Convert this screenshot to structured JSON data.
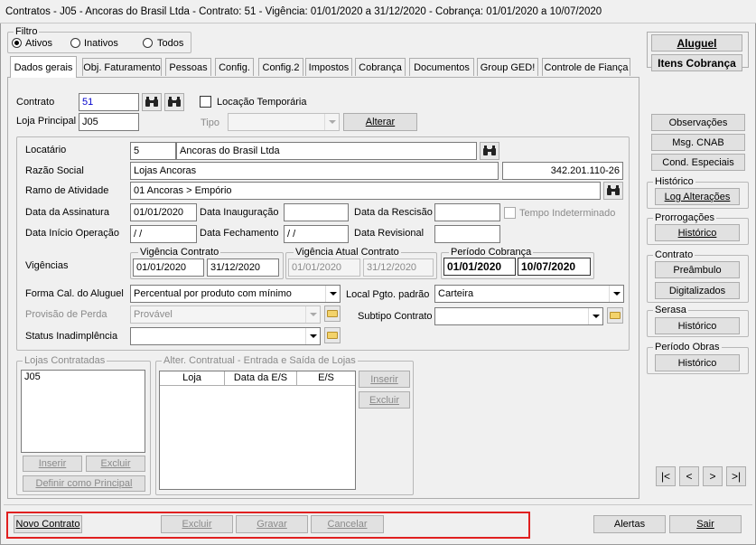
{
  "window": {
    "title": "Contratos - J05 - Ancoras do Brasil Ltda - Contrato: 51 - Vigência: 01/01/2020 a 31/12/2020 - Cobrança: 01/01/2020 a 10/07/2020"
  },
  "filtro": {
    "label": "Filtro",
    "options": [
      "Ativos",
      "Inativos",
      "Todos"
    ],
    "selected": "Ativos"
  },
  "tabs": [
    "Dados gerais",
    "Obj. Faturamento",
    "Pessoas",
    "Config.",
    "Config.2",
    "Impostos",
    "Cobrança",
    "Documentos",
    "Group GED!",
    "Controle de Fiança"
  ],
  "contrato": {
    "label": "Contrato",
    "value": "51",
    "locacao_temporaria": "Locação Temporária",
    "loja_principal_label": "Loja Principal",
    "loja_principal": "J05",
    "tipo_label": "Tipo",
    "tipo": "",
    "alterar": "Alterar"
  },
  "locatario": {
    "label": "Locatário",
    "code": "5",
    "name": "Ancoras do Brasil Ltda",
    "razao_label": "Razão Social",
    "razao": "Lojas Ancoras",
    "cnpj": "342.201.110-26",
    "ramo_label": "Ramo de Atividade",
    "ramo": "01 Ancoras > Empório"
  },
  "datas": {
    "assinatura_label": "Data da Assinatura",
    "assinatura": "01/01/2020",
    "inauguracao_label": "Data Inauguração",
    "inauguracao": "",
    "rescisao_label": "Data da Rescisão",
    "rescisao": "",
    "tempo_indeterminado": "Tempo Indeterminado",
    "inicio_label": "Data Início Operação",
    "inicio": " / /",
    "fechamento_label": "Data Fechamento",
    "fechamento": " / /",
    "revisional_label": "Data Revisional",
    "revisional": ""
  },
  "vigencias": {
    "label": "Vigências",
    "contrato_label": "Vigência Contrato",
    "contrato_ini": "01/01/2020",
    "contrato_fim": "31/12/2020",
    "atual_label": "Vigência Atual Contrato",
    "atual_ini": "01/01/2020",
    "atual_fim": "31/12/2020",
    "cobranca_label": "Período Cobrança",
    "cobranca_ini": "01/01/2020",
    "cobranca_fim": "10/07/2020"
  },
  "calculo": {
    "forma_label": "Forma Cal. do Aluguel",
    "forma": "Percentual por produto com mínimo",
    "local_label": "Local Pgto. padrão",
    "local": "Carteira",
    "provisao_label": "Provisão de Perda",
    "provisao": "Provável",
    "subtipo_label": "Subtipo Contrato",
    "subtipo": "",
    "status_label": "Status Inadimplência",
    "status": ""
  },
  "lojas": {
    "label": "Lojas Contratadas",
    "items": [
      "J05"
    ],
    "inserir": "Inserir",
    "excluir": "Excluir",
    "definir": "Definir como Principal"
  },
  "alter": {
    "label": "Alter. Contratual - Entrada e Saída de Lojas",
    "columns": [
      "Loja",
      "Data da E/S",
      "E/S"
    ],
    "inserir": "Inserir",
    "excluir": "Excluir"
  },
  "right": {
    "aluguel": "Aluguel",
    "itens": "Itens Cobrança",
    "observacoes": "Observações",
    "msg_cnab": "Msg. CNAB",
    "cond": "Cond. Especiais",
    "historico_label": "Histórico",
    "log": "Log Alterações",
    "prorrogacoes_label": "Prorrogações",
    "prorrogacoes_btn": "Histórico",
    "contrato_label": "Contrato",
    "preambulo": "Preâmbulo",
    "digitalizados": "Digitalizados",
    "serasa_label": "Serasa",
    "serasa_btn": "Histórico",
    "obras_label": "Período Obras",
    "obras_btn": "Histórico"
  },
  "nav": {
    "first": "|<",
    "prev": "<",
    "next": ">",
    "last": ">|"
  },
  "bottom": {
    "novo": "Novo Contrato",
    "excluir": "Excluir",
    "gravar": "Gravar",
    "cancelar": "Cancelar",
    "alertas": "Alertas",
    "sair": "Sair"
  },
  "colors": {
    "highlight": "#e02020",
    "link_value": "#0000cc"
  }
}
